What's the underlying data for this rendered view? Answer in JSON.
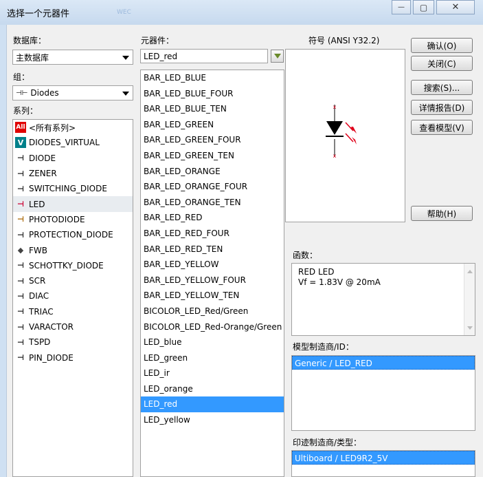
{
  "window": {
    "title": "选择一个元器件",
    "ghost_text": "WEC",
    "minimize_glyph": "—",
    "maximize_glyph": "▢",
    "close_glyph": "✕"
  },
  "database": {
    "label": "数据库：",
    "value": "主数据库"
  },
  "group": {
    "label": "组：",
    "value": "Diodes",
    "icon": "diode-group-icon"
  },
  "family": {
    "label": "系列：",
    "items": [
      {
        "label": "<所有系列>",
        "icon": "all-icon"
      },
      {
        "label": "DIODES_VIRTUAL",
        "icon": "virtual-diode-icon"
      },
      {
        "label": "DIODE",
        "icon": "diode-icon"
      },
      {
        "label": "ZENER",
        "icon": "zener-icon"
      },
      {
        "label": "SWITCHING_DIODE",
        "icon": "switching-diode-icon"
      },
      {
        "label": "LED",
        "icon": "led-icon"
      },
      {
        "label": "PHOTODIODE",
        "icon": "photodiode-icon"
      },
      {
        "label": "PROTECTION_DIODE",
        "icon": "protection-diode-icon"
      },
      {
        "label": "FWB",
        "icon": "bridge-icon"
      },
      {
        "label": "SCHOTTKY_DIODE",
        "icon": "schottky-icon"
      },
      {
        "label": "SCR",
        "icon": "scr-icon"
      },
      {
        "label": "DIAC",
        "icon": "diac-icon"
      },
      {
        "label": "TRIAC",
        "icon": "triac-icon"
      },
      {
        "label": "VARACTOR",
        "icon": "varactor-icon"
      },
      {
        "label": "TSPD",
        "icon": "tspd-icon"
      },
      {
        "label": "PIN_DIODE",
        "icon": "pin-diode-icon"
      }
    ]
  },
  "component": {
    "label": "元器件：",
    "search_value": "LED_red",
    "filter_icon": "filter-icon",
    "items": [
      "BAR_LED_BLUE",
      "BAR_LED_BLUE_FOUR",
      "BAR_LED_BLUE_TEN",
      "BAR_LED_GREEN",
      "BAR_LED_GREEN_FOUR",
      "BAR_LED_GREEN_TEN",
      "BAR_LED_ORANGE",
      "BAR_LED_ORANGE_FOUR",
      "BAR_LED_ORANGE_TEN",
      "BAR_LED_RED",
      "BAR_LED_RED_FOUR",
      "BAR_LED_RED_TEN",
      "BAR_LED_YELLOW",
      "BAR_LED_YELLOW_FOUR",
      "BAR_LED_YELLOW_TEN",
      "BICOLOR_LED_Red/Green",
      "BICOLOR_LED_Red-Orange/Green",
      "LED_blue",
      "LED_green",
      "LED_ir",
      "LED_orange",
      "LED_red",
      "LED_yellow"
    ],
    "selected": "LED_red"
  },
  "symbol": {
    "label": "符号 (ANSI Y32.2)",
    "icon": "led-symbol-icon"
  },
  "function": {
    "label": "函数：",
    "line1": "RED LED",
    "line2": "Vf = 1.83V @ 20mA"
  },
  "model_mfr": {
    "label": "模型制造商/ID：",
    "value": "Generic / LED_RED"
  },
  "footprint_mfr": {
    "label": "印迹制造商/类型：",
    "value": "Ultiboard / LED9R2_5V"
  },
  "buttons": {
    "ok": "确认(O)",
    "close": "关闭(C)",
    "search": "搜索(S)...",
    "detail_report": "详情报告(D)",
    "view_model": "查看模型(V)",
    "help": "帮助(H)"
  },
  "colors": {
    "selection": "#3399ff",
    "all_icon_bg": "#e00000",
    "virtual_icon_bg": "#00808a",
    "led_red": "#e0001a"
  }
}
